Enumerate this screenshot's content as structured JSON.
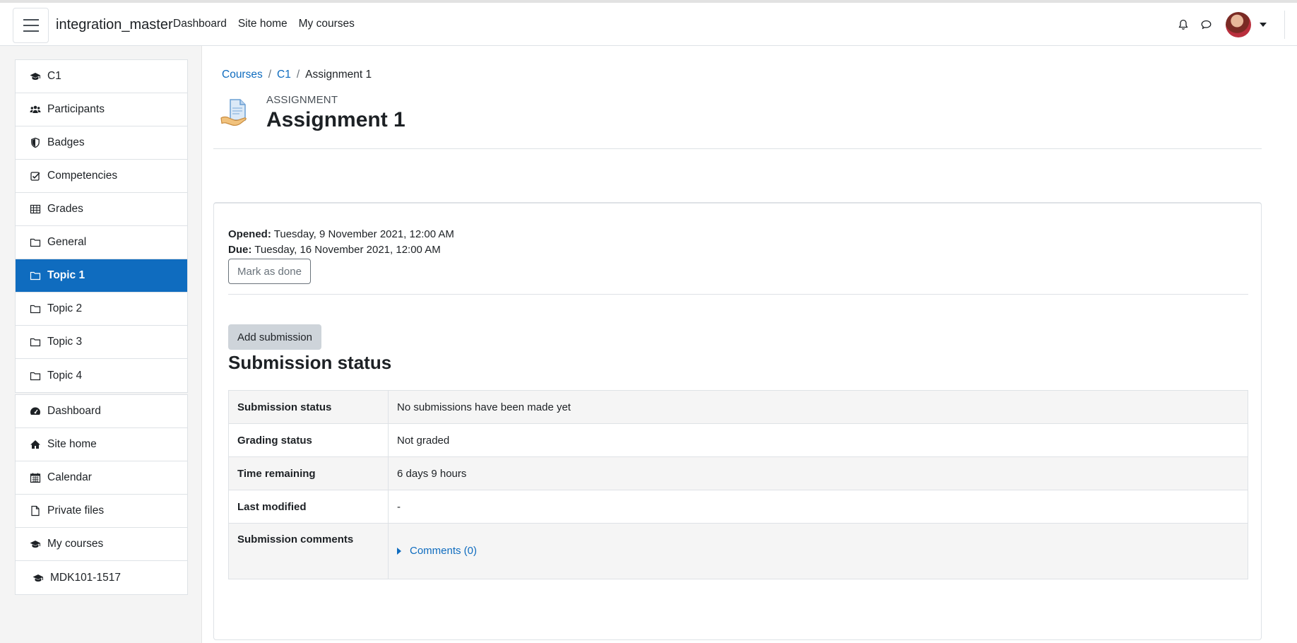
{
  "navbar": {
    "brand": "integration_master",
    "links": [
      "Dashboard",
      "Site home",
      "My courses"
    ],
    "icons": [
      "bell-icon",
      "chat-icon"
    ]
  },
  "drawer": {
    "course_items": [
      {
        "label": "C1",
        "icon": "graduation-cap-icon"
      },
      {
        "label": "Participants",
        "icon": "users-icon"
      },
      {
        "label": "Badges",
        "icon": "shield-icon"
      },
      {
        "label": "Competencies",
        "icon": "check-square-icon"
      },
      {
        "label": "Grades",
        "icon": "table-icon"
      },
      {
        "label": "General",
        "icon": "folder-icon"
      },
      {
        "label": "Topic 1",
        "icon": "folder-icon",
        "active": true
      },
      {
        "label": "Topic 2",
        "icon": "folder-icon"
      },
      {
        "label": "Topic 3",
        "icon": "folder-icon"
      },
      {
        "label": "Topic 4",
        "icon": "folder-icon"
      }
    ],
    "site_items": [
      {
        "label": "Dashboard",
        "icon": "dashboard-icon"
      },
      {
        "label": "Site home",
        "icon": "home-icon"
      },
      {
        "label": "Calendar",
        "icon": "calendar-icon"
      },
      {
        "label": "Private files",
        "icon": "file-icon"
      },
      {
        "label": "My courses",
        "icon": "graduation-cap-icon"
      },
      {
        "label": "MDK101-1517",
        "icon": "graduation-cap-icon"
      }
    ]
  },
  "breadcrumb": [
    "Courses",
    "C1",
    "Assignment 1"
  ],
  "header": {
    "purpose": "ASSIGNMENT",
    "title": "Assignment 1"
  },
  "dates": {
    "opened_label": "Opened:",
    "opened_value": "Tuesday, 9 November 2021, 12:00 AM",
    "due_label": "Due:",
    "due_value": "Tuesday, 16 November 2021, 12:00 AM"
  },
  "buttons": {
    "mark_done": "Mark as done",
    "add_submission": "Add submission"
  },
  "submission": {
    "heading": "Submission status",
    "rows": [
      {
        "label": "Submission status",
        "value": "No submissions have been made yet"
      },
      {
        "label": "Grading status",
        "value": "Not graded"
      },
      {
        "label": "Time remaining",
        "value": "6 days 9 hours"
      },
      {
        "label": "Last modified",
        "value": "-"
      },
      {
        "label": "Submission comments",
        "value": "Comments (0)"
      }
    ]
  },
  "colors": {
    "accent": "#0f6cbf",
    "text": "#1d2125"
  }
}
